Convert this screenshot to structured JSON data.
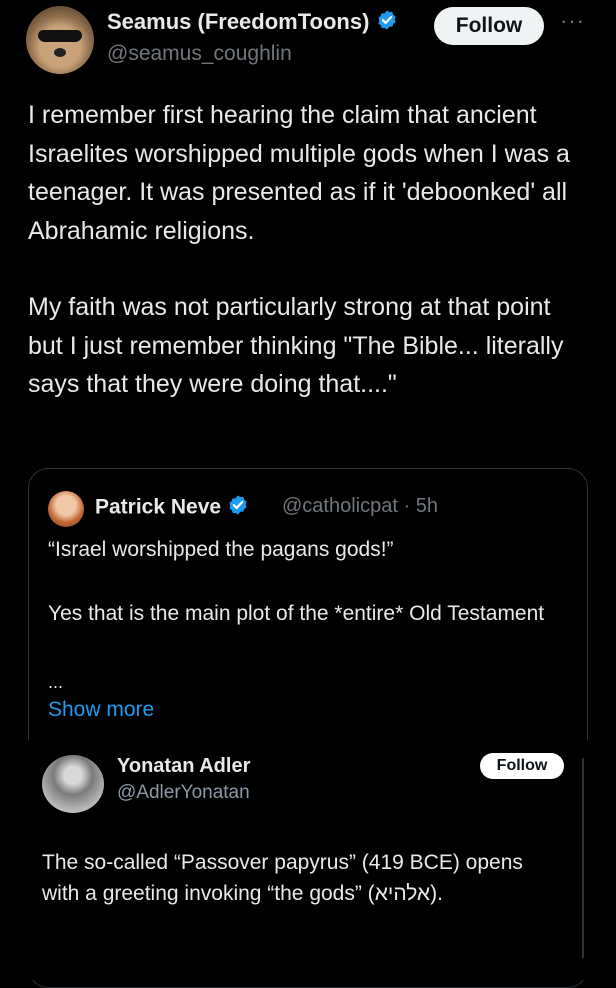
{
  "tweet": {
    "author_name": "Seamus (FreedomToons)",
    "author_handle": "@seamus_coughlin",
    "follow_label": "Follow",
    "more_label": "···",
    "paragraphs": [
      "I remember first hearing the claim that ancient Israelites worshipped multiple gods when I was a teenager.  It was presented as if it 'deboonked' all Abrahamic religions.",
      "My faith was not particularly strong at that point but I just remember thinking \"The Bible... literally says that they were doing that....\""
    ]
  },
  "quote": {
    "author_name": "Patrick Neve",
    "author_handle": "@catholicpat",
    "time": "5h",
    "paragraphs": [
      "“Israel worshipped the pagans gods!”",
      "Yes that is the main plot of the *entire* Old Testament"
    ],
    "ellipsis": "...",
    "show_more_label": "Show more"
  },
  "embedded": {
    "author_name": "Yonatan Adler",
    "author_handle": "@AdlerYonatan",
    "follow_label": "Follow",
    "text": "The so-called “Passover papyrus” (419 BCE) opens with a greeting invoking “the gods” (אלהיא)."
  },
  "colors": {
    "verified": "#1d9bf0",
    "link": "#1d9bf0",
    "background": "#000000"
  }
}
